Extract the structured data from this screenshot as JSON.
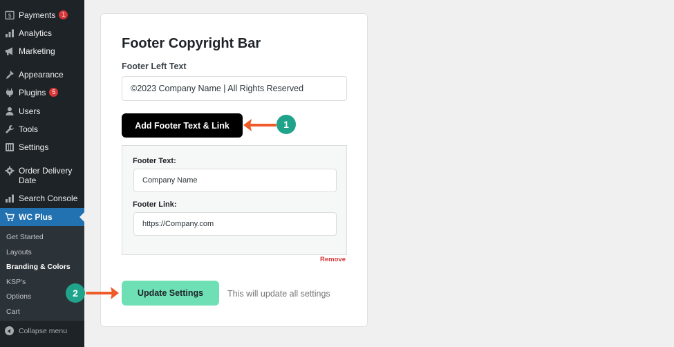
{
  "sidebar": {
    "items": [
      {
        "label": "Payments",
        "icon": "payments-icon",
        "badge": "1"
      },
      {
        "label": "Analytics",
        "icon": "analytics-icon"
      },
      {
        "label": "Marketing",
        "icon": "marketing-icon"
      },
      {
        "label": "Appearance",
        "icon": "appearance-icon"
      },
      {
        "label": "Plugins",
        "icon": "plugins-icon",
        "badge": "5"
      },
      {
        "label": "Users",
        "icon": "users-icon"
      },
      {
        "label": "Tools",
        "icon": "tools-icon"
      },
      {
        "label": "Settings",
        "icon": "settings-icon"
      },
      {
        "label": "Order Delivery Date",
        "icon": "order-delivery-icon"
      },
      {
        "label": "Search Console",
        "icon": "search-console-icon"
      },
      {
        "label": "WC Plus",
        "icon": "cart-icon"
      }
    ],
    "submenu": [
      {
        "label": "Get Started"
      },
      {
        "label": "Layouts"
      },
      {
        "label": "Branding & Colors"
      },
      {
        "label": "KSP's"
      },
      {
        "label": "Options"
      },
      {
        "label": "Cart"
      }
    ],
    "collapse_label": "Collapse menu"
  },
  "card": {
    "title": "Footer Copyright Bar",
    "left_text_label": "Footer Left Text",
    "left_text_value": "©2023 Company Name | All Rights Reserved",
    "add_button_label": "Add Footer Text & Link",
    "repeater": {
      "text_label": "Footer Text:",
      "text_value": "Company Name",
      "link_label": "Footer Link:",
      "link_value": "https://Company.com"
    },
    "remove_label": "Remove",
    "update_button_label": "Update Settings",
    "update_help_text": "This will update all settings"
  },
  "annotations": {
    "step1": "1",
    "step2": "2",
    "arrow_color": "#f05a28",
    "badge_color": "#1fa38a"
  },
  "colors": {
    "sidebar_bg": "#1d2327",
    "active_menu": "#2271b1",
    "update_button": "#6fdfb5",
    "badge": "#d63638"
  }
}
